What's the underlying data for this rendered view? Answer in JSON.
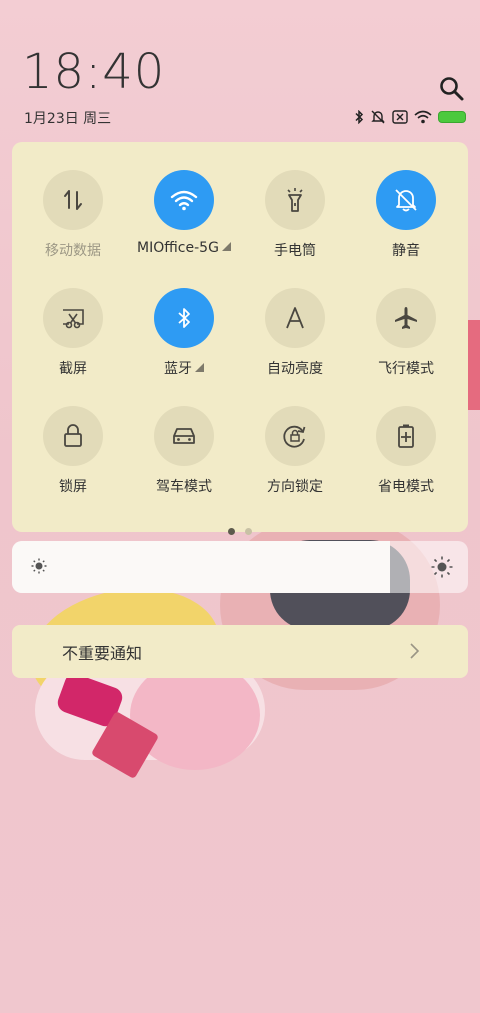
{
  "status": {
    "time": "18:40",
    "date": "1月23日 周三",
    "battery_color": "#4cc93d"
  },
  "search": {
    "icon": "search-icon"
  },
  "quick_settings": {
    "tiles": [
      {
        "label": "移动数据",
        "icon": "mobile-data-icon",
        "active": false,
        "dim": true
      },
      {
        "label": "MIOffice-5G",
        "icon": "wifi-icon",
        "active": true
      },
      {
        "label": "手电筒",
        "icon": "flashlight-icon",
        "active": false
      },
      {
        "label": "静音",
        "icon": "mute-bell-icon",
        "active": true
      },
      {
        "label": "截屏",
        "icon": "screenshot-icon",
        "active": false
      },
      {
        "label": "蓝牙",
        "icon": "bluetooth-icon",
        "active": true
      },
      {
        "label": "自动亮度",
        "icon": "auto-brightness-icon",
        "active": false
      },
      {
        "label": "飞行模式",
        "icon": "airplane-icon",
        "active": false
      },
      {
        "label": "锁屏",
        "icon": "lock-icon",
        "active": false
      },
      {
        "label": "驾车模式",
        "icon": "car-icon",
        "active": false
      },
      {
        "label": "方向锁定",
        "icon": "rotation-lock-icon",
        "active": false
      },
      {
        "label": "省电模式",
        "icon": "battery-saver-icon",
        "active": false
      }
    ],
    "page_count": 2,
    "current_page": 1,
    "accent": "#2e9bf3"
  },
  "brightness": {
    "level": 0.83
  },
  "notification": {
    "label": "不重要通知"
  }
}
